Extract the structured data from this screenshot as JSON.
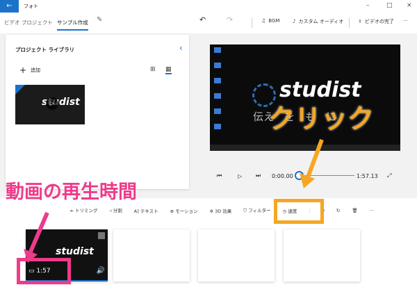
{
  "window": {
    "title": "フォト",
    "back_icon": "arrow-left-icon",
    "minimize": "–",
    "maximize": "□",
    "close": "×"
  },
  "header": {
    "breadcrumb": [
      "ビデオ プロジェクト",
      "サンプル作成"
    ],
    "edit_icon": "pencil-icon",
    "undo": "↶",
    "redo": "↷",
    "bgm": "BGM",
    "custom_audio": "カスタム オーディオ",
    "finish": "ビデオの完了",
    "more": "···"
  },
  "library": {
    "title": "プロジェクト ライブラリ",
    "add": "追加",
    "thumb_text": "studist"
  },
  "preview": {
    "title_text": "studist",
    "subtitle": "伝え　を　も　に",
    "current_time": "0:00.00",
    "total_time": "1:57.13",
    "progress": 0
  },
  "toolbar": {
    "items": [
      "トリミング",
      "分割",
      "テキスト",
      "モーション",
      "3D 効果",
      "フィルター",
      "速度"
    ],
    "more": "···"
  },
  "storyboard": {
    "clips": [
      {
        "text": "studist",
        "duration": "1:57"
      }
    ]
  },
  "annotations": {
    "click": "クリック",
    "duration_label": "動画の再生時間",
    "pink": "#ee3b8b",
    "orange": "#f5a623"
  },
  "accent": "#1a73c9"
}
